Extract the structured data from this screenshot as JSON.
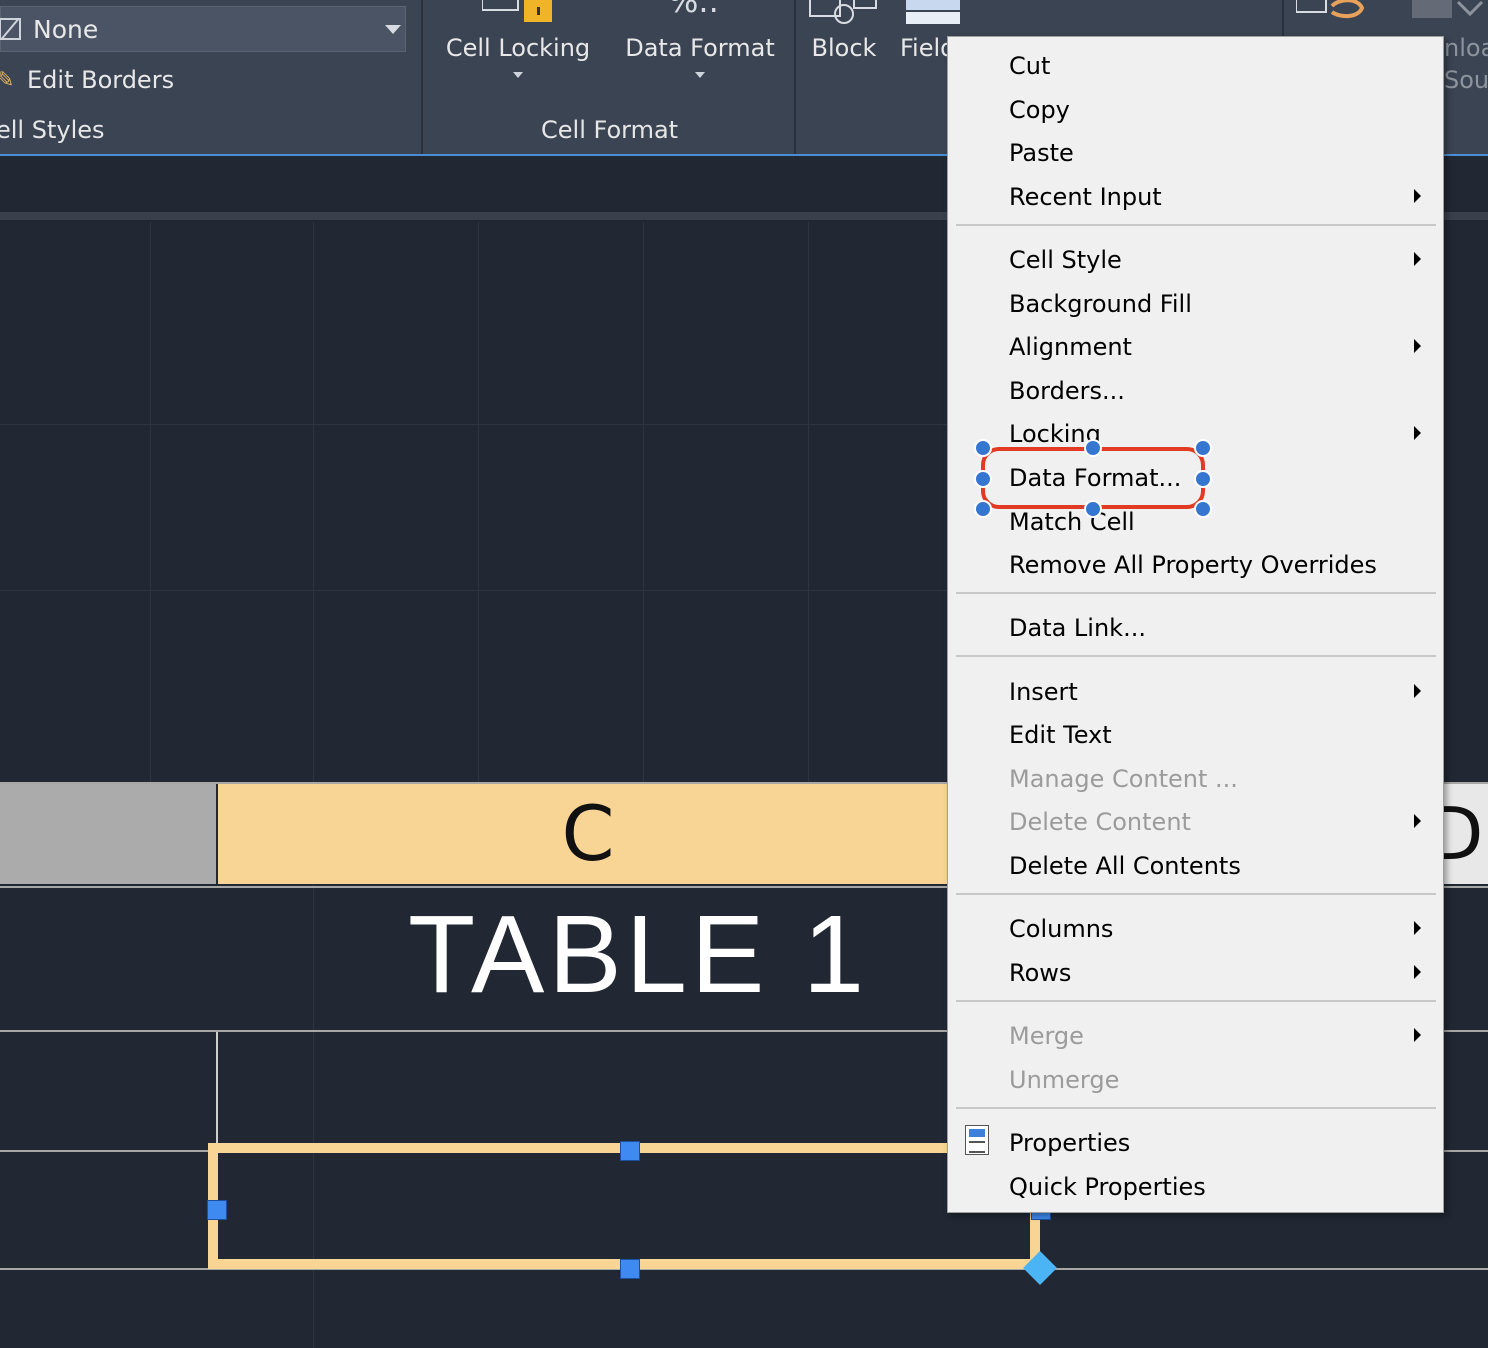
{
  "ribbon": {
    "cell_styles_panel": {
      "style_select_value": "None",
      "edit_borders_label": "Edit Borders",
      "title": "ell Styles"
    },
    "cell_format_panel": {
      "cell_locking_label": "Cell Locking",
      "data_format_label": "Data Format",
      "data_format_icon_text": "%..",
      "title": "Cell Format"
    },
    "insert_panel": {
      "block_label": "Block",
      "field_label": "Field"
    },
    "right_clipped": {
      "line1": "nloa",
      "line2": "Sou"
    }
  },
  "drawing": {
    "column_header_c": "C",
    "column_header_d": "D",
    "table_title": "TABLE 1"
  },
  "context_menu": {
    "items": [
      {
        "label": "Cut",
        "submenu": false,
        "disabled": false
      },
      {
        "label": "Copy",
        "submenu": false,
        "disabled": false
      },
      {
        "label": "Paste",
        "submenu": false,
        "disabled": false
      },
      {
        "label": "Recent Input",
        "submenu": true,
        "disabled": false
      },
      {
        "label": "Cell Style",
        "submenu": true,
        "disabled": false
      },
      {
        "label": "Background Fill",
        "submenu": false,
        "disabled": false
      },
      {
        "label": "Alignment",
        "submenu": true,
        "disabled": false
      },
      {
        "label": "Borders...",
        "submenu": false,
        "disabled": false
      },
      {
        "label": "Locking",
        "submenu": true,
        "disabled": false
      },
      {
        "label": "Data Format...",
        "submenu": false,
        "disabled": false
      },
      {
        "label": "Match Cell",
        "submenu": false,
        "disabled": false
      },
      {
        "label": "Remove All Property Overrides",
        "submenu": false,
        "disabled": false
      },
      {
        "label": "Data Link...",
        "submenu": false,
        "disabled": false
      },
      {
        "label": "Insert",
        "submenu": true,
        "disabled": false
      },
      {
        "label": "Edit Text",
        "submenu": false,
        "disabled": false
      },
      {
        "label": "Manage Content ...",
        "submenu": false,
        "disabled": true
      },
      {
        "label": "Delete Content",
        "submenu": true,
        "disabled": true
      },
      {
        "label": "Delete All Contents",
        "submenu": false,
        "disabled": false
      },
      {
        "label": "Columns",
        "submenu": true,
        "disabled": false
      },
      {
        "label": "Rows",
        "submenu": true,
        "disabled": false
      },
      {
        "label": "Merge",
        "submenu": true,
        "disabled": true
      },
      {
        "label": "Unmerge",
        "submenu": false,
        "disabled": true
      },
      {
        "label": "Properties",
        "submenu": false,
        "disabled": false,
        "icon": "properties-icon"
      },
      {
        "label": "Quick Properties",
        "submenu": false,
        "disabled": false
      }
    ],
    "highlighted_item": "Data Format..."
  },
  "colors": {
    "background": "#212733",
    "ribbon": "#3b4453",
    "menu_background": "#f0f0f0",
    "header_cell": "#f8d595",
    "annotation": "#e23b24",
    "grip": "#3f8af0"
  }
}
